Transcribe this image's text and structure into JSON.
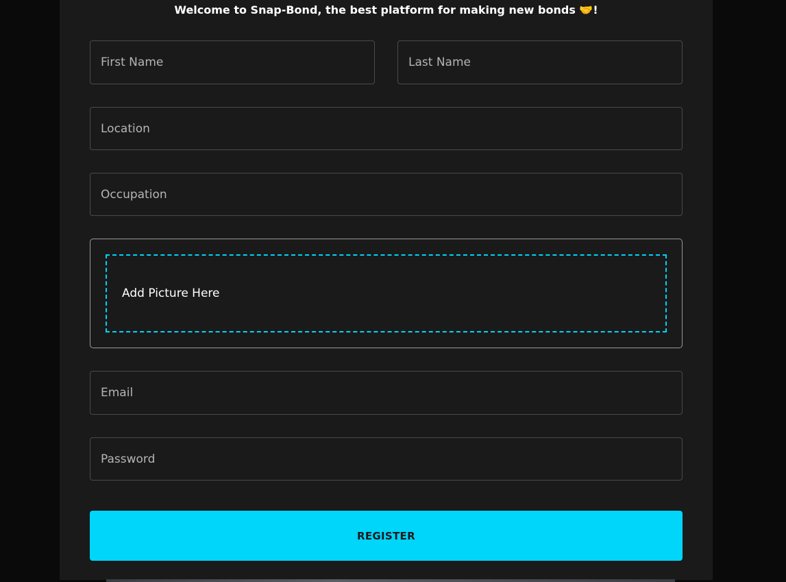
{
  "header": {
    "welcome_text": "Welcome to Snap-Bond, the best platform for making new bonds 🤝!"
  },
  "form": {
    "first_name_placeholder": "First Name",
    "last_name_placeholder": "Last Name",
    "location_placeholder": "Location",
    "occupation_placeholder": "Occupation",
    "picture_label": "Add Picture Here",
    "email_placeholder": "Email",
    "password_placeholder": "Password",
    "register_label": "REGISTER"
  },
  "colors": {
    "accent": "#00d5fa",
    "panel_bg": "#1a1a1a",
    "page_bg": "#0a0a0a"
  }
}
